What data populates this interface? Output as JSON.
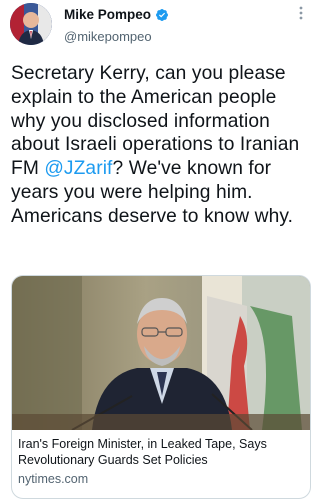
{
  "author": {
    "name": "Mike Pompeo",
    "handle": "@mikepompeo"
  },
  "tweet": {
    "text_before": "Secretary Kerry, can you please explain to the American people why you disclosed information about Israeli operations to Iranian FM ",
    "mention": "@JZarif",
    "text_after": "? We've known for years you were helping him. Americans deserve to know why."
  },
  "card": {
    "title": "Iran's Foreign Minister, in Leaked Tape, Says Revolutionary Guards Set Policies",
    "domain": "nytimes.com"
  },
  "colors": {
    "accent": "#1d9bf0",
    "text": "#0f1419",
    "secondary": "#536471"
  },
  "icons": [
    "verified-badge-icon",
    "more-options-icon"
  ]
}
